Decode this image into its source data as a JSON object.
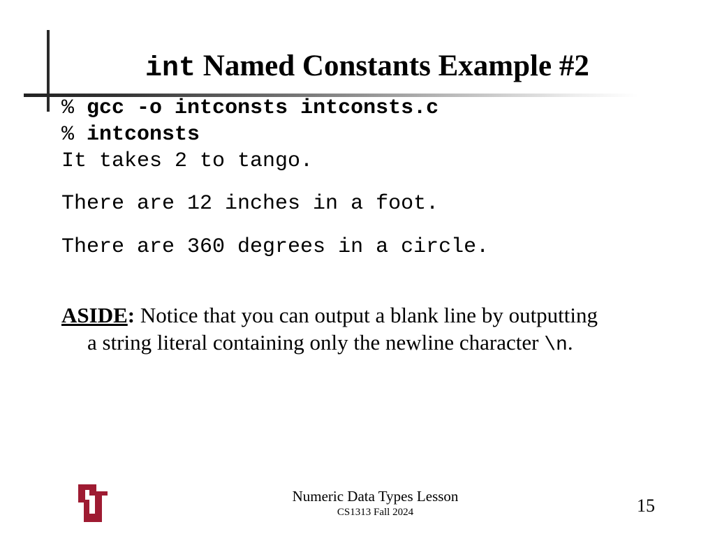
{
  "slide": {
    "title": {
      "code_part": "int",
      "text_part": "Named Constants Example #2"
    },
    "terminal": {
      "lines": [
        {
          "prompt": "%",
          "command": "gcc -o intconsts intconsts.c"
        },
        {
          "prompt": "%",
          "command": "intconsts"
        }
      ],
      "output": [
        "It takes 2 to tango.",
        "There are 12 inches in a foot.",
        "There are 360 degrees in a circle."
      ]
    },
    "aside": {
      "label": "ASIDE",
      "colon": ":",
      "line1": " Notice that you can output a blank line by outputting",
      "line2": "a string literal containing only the newline character ",
      "code": "\\n",
      "end": "."
    },
    "footer": {
      "title": "Numeric Data Types Lesson",
      "subtitle": "CS1313 Fall 2024",
      "page_number": "15"
    },
    "logo": {
      "icon": "ou-logo-icon",
      "color": "#9e1b32"
    }
  }
}
